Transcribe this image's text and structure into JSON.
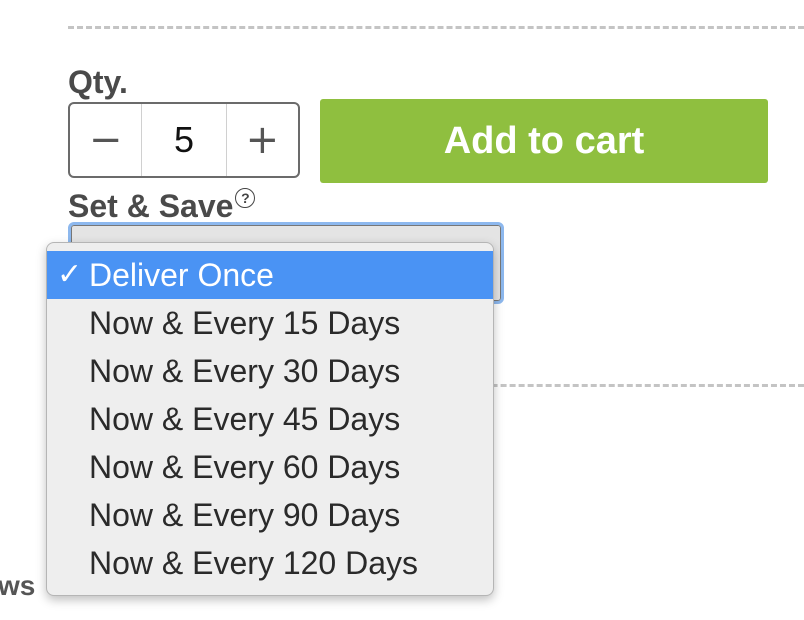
{
  "qty": {
    "label": "Qty.",
    "minus_glyph": "−",
    "value": "5",
    "plus_glyph": "+"
  },
  "cart": {
    "button_label": "Add to cart",
    "color": "#8fbf3f"
  },
  "setsave": {
    "label": "Set & Save",
    "help_glyph": "?"
  },
  "dropdown": {
    "check_glyph": "✓",
    "selected_color": "#4a93f4",
    "options": [
      {
        "label": "Deliver Once",
        "selected": true
      },
      {
        "label": "Now & Every 15 Days",
        "selected": false
      },
      {
        "label": "Now & Every 30 Days",
        "selected": false
      },
      {
        "label": "Now & Every 45 Days",
        "selected": false
      },
      {
        "label": "Now & Every 60 Days",
        "selected": false
      },
      {
        "label": "Now & Every 90 Days",
        "selected": false
      },
      {
        "label": "Now & Every 120 Days",
        "selected": false
      }
    ]
  },
  "background": {
    "partial_text": "ws"
  }
}
